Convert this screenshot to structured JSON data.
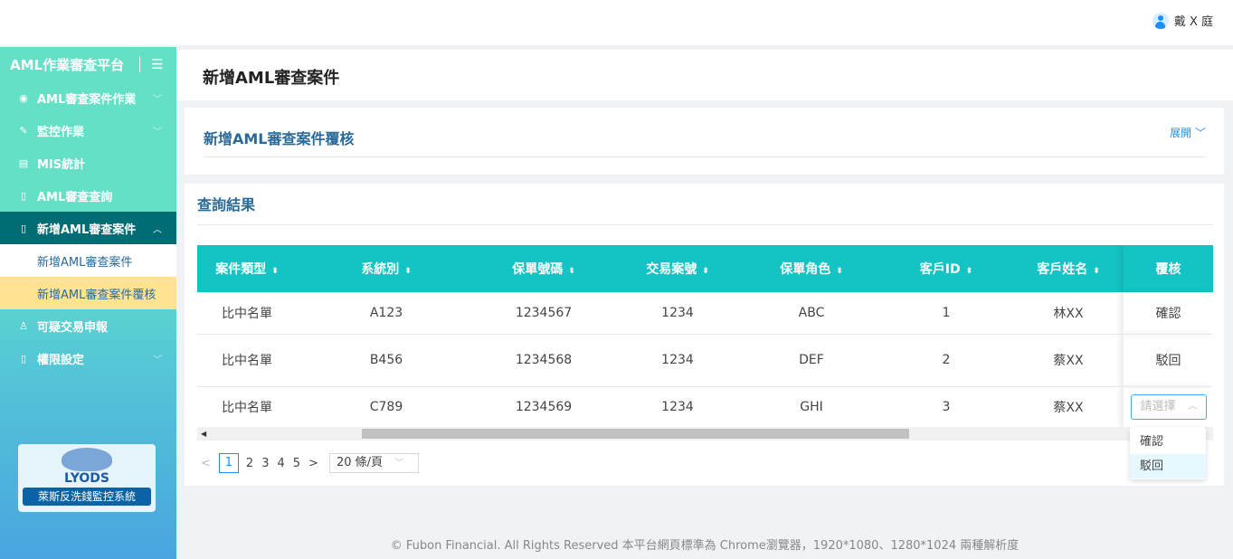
{
  "user": {
    "name": "戴 X 庭"
  },
  "sidebar": {
    "brand": "AML作業審查平台",
    "items": [
      {
        "label": "AML審查案件作業",
        "icon": "eye-icon"
      },
      {
        "label": "監控作業",
        "icon": "edit-icon"
      },
      {
        "label": "MIS統計",
        "icon": "list-icon"
      },
      {
        "label": "AML審查查詢",
        "icon": "file-search-icon"
      },
      {
        "label": "新增AML審查案件",
        "icon": "file-add-icon"
      },
      {
        "label": "可疑交易申報",
        "icon": "user-icon"
      },
      {
        "label": "權限設定",
        "icon": "file-lock-icon"
      }
    ],
    "subitems": [
      "新增AML審查案件",
      "新增AML審查案件覆核"
    ],
    "logo": {
      "word": "LYODS",
      "caption": "萊斯反洗錢監控系統"
    }
  },
  "page": {
    "title": "新增AML審查案件"
  },
  "search_card": {
    "title": "新增AML審查案件覆核",
    "expand": "展開"
  },
  "results": {
    "title": "查詢結果",
    "columns": [
      "案件類型",
      "系統別",
      "保單號碼",
      "交易案號",
      "保單角色",
      "客戶ID",
      "客戶姓名",
      "覆核"
    ],
    "rows": [
      [
        "比中名單",
        "A123",
        "1234567",
        "1234",
        "ABC",
        "1",
        "林XX",
        "確認"
      ],
      [
        "比中名單",
        "B456",
        "1234568",
        "1234",
        "DEF",
        "2",
        "蔡XX",
        "駁回"
      ],
      [
        "比中名單",
        "C789",
        "1234569",
        "1234",
        "GHI",
        "3",
        "蔡XX",
        ""
      ]
    ],
    "select_placeholder": "請選擇",
    "options": [
      "確認",
      "駁回"
    ]
  },
  "pagination": {
    "pages": [
      "1",
      "2",
      "3",
      "4",
      "5"
    ],
    "current": "1",
    "page_size": "20 條/頁"
  },
  "footer": "© Fubon Financial. All Rights Reserved 本平台網頁標準為 Chrome瀏覽器，1920*1080、1280*1024 兩種解析度"
}
